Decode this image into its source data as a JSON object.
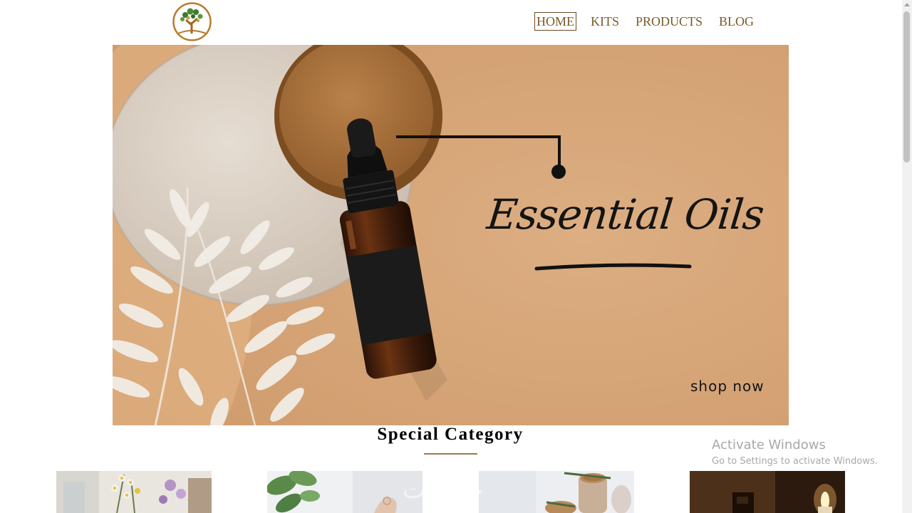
{
  "nav": {
    "items": [
      {
        "label": "HOME",
        "active": true
      },
      {
        "label": "KITS",
        "active": false
      },
      {
        "label": "PRODUCTS",
        "active": false
      },
      {
        "label": "BLOG",
        "active": false
      }
    ]
  },
  "hero": {
    "title": "Essential Oils",
    "cta": "shop now"
  },
  "section": {
    "title": "Special Category"
  },
  "categories": [
    {
      "icon": "flowers-photo"
    },
    {
      "icon": "plant-hand-photo"
    },
    {
      "icon": "jars-photo"
    },
    {
      "icon": "candle-photo"
    }
  ],
  "watermark": {
    "title": "Activate Windows",
    "subtitle": "Go to Settings to activate Windows.",
    "site": "خمسات"
  },
  "colors": {
    "brand": "#7a5a2a",
    "hero_bg": "#d8a77a",
    "rule": "#9a7a4a"
  }
}
